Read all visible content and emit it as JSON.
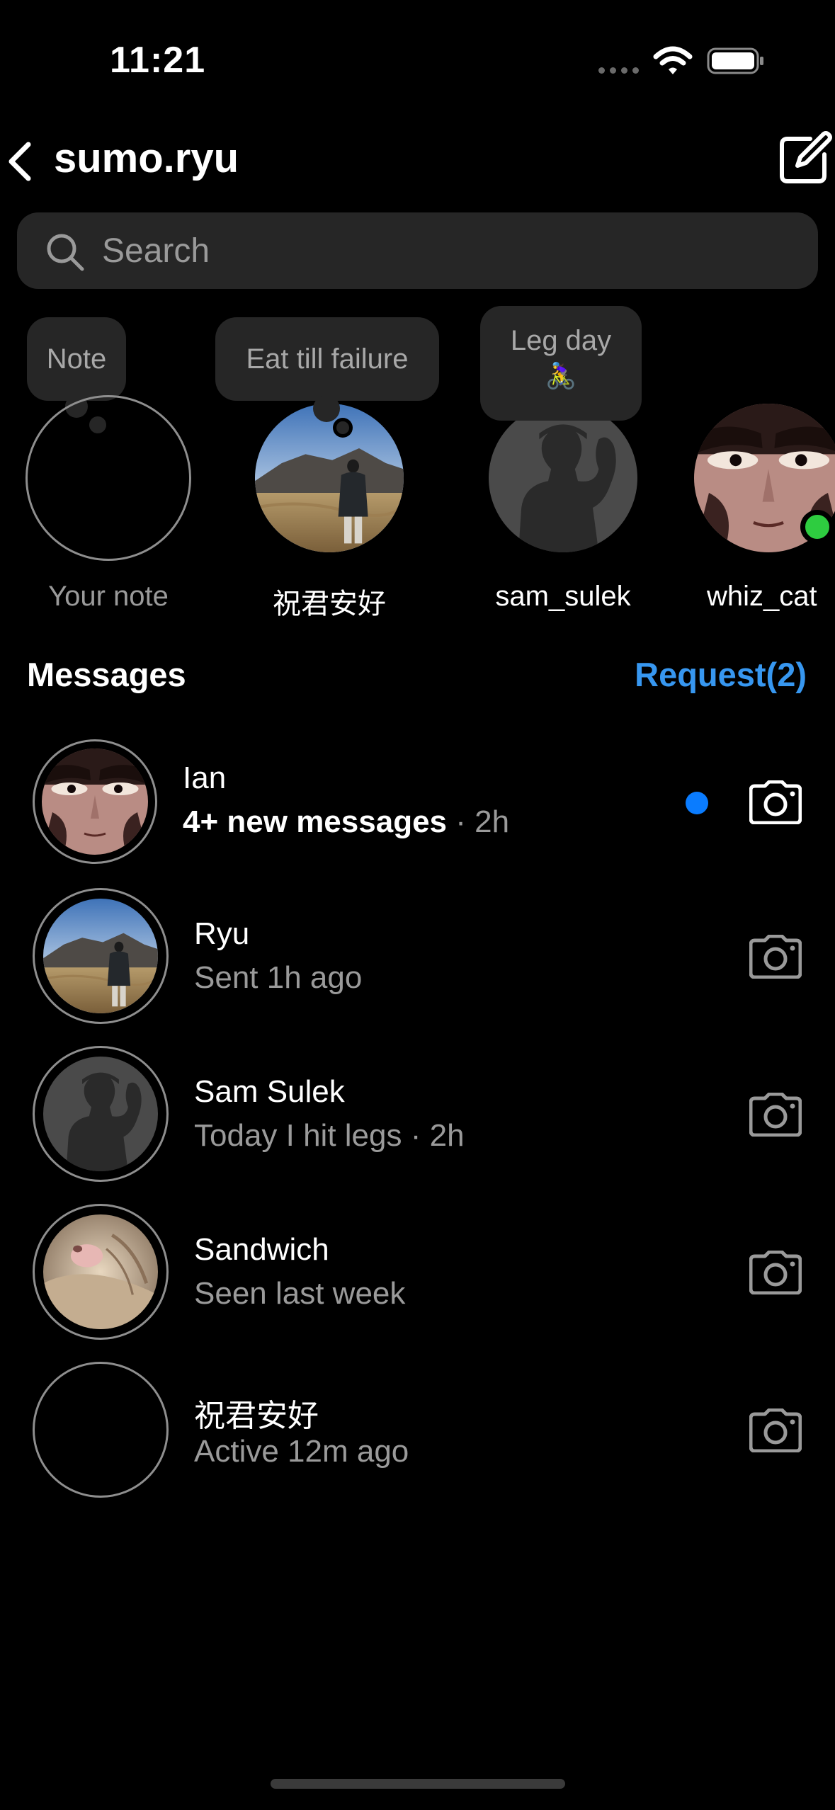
{
  "status_bar": {
    "time": "11:21"
  },
  "header": {
    "back_icon": "chevron-left-icon",
    "title": "sumo.ryu",
    "compose_icon": "compose-icon"
  },
  "search": {
    "placeholder": "Search",
    "value": "",
    "icon": "search-icon"
  },
  "notes": [
    {
      "bubble": "Note",
      "label": "Your note",
      "avatar": "empty"
    },
    {
      "bubble": "Eat till failure",
      "label": "祝君安好",
      "avatar": "mountain-photo"
    },
    {
      "bubble_line1": "Leg day",
      "bubble_line2": "🚴‍♀️",
      "label": "sam_sulek",
      "avatar": "silhouette"
    },
    {
      "label": "whiz_cat",
      "avatar": "anime-eyes",
      "online": true
    }
  ],
  "messages_section": {
    "title": "Messages",
    "request_label": "Request(2)"
  },
  "threads": [
    {
      "name": "Ian",
      "subtitle": "4+ new messages",
      "time": "2h",
      "unread": true,
      "avatar": "anime-eyes"
    },
    {
      "name": "Ryu",
      "subtitle": "Sent 1h ago",
      "unread": false,
      "avatar": "mountain-photo"
    },
    {
      "name": "Sam Sulek",
      "subtitle": "Today I hit legs",
      "time": "2h",
      "unread": false,
      "avatar": "silhouette"
    },
    {
      "name": "Sandwich",
      "subtitle": "Seen last week",
      "unread": false,
      "avatar": "cat-photo"
    },
    {
      "name": "祝君安好",
      "subtitle": "Active 12m ago",
      "unread": false,
      "avatar": "empty"
    }
  ],
  "colors": {
    "background": "#000000",
    "accent": "#3797f0",
    "unread": "#0a7cff",
    "online": "#2ecc40",
    "surface": "#262626"
  }
}
